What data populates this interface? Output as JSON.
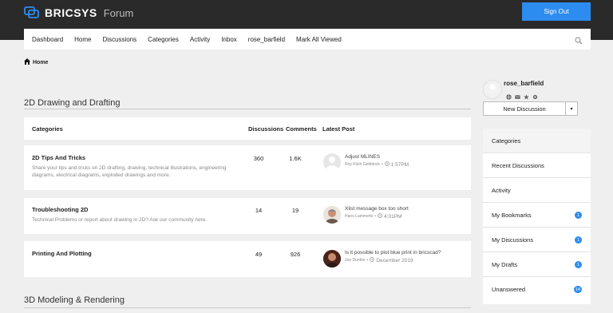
{
  "header": {
    "brand": "BRICSYS",
    "product": "Forum",
    "signout_label": "Sign Out"
  },
  "nav": {
    "items": [
      "Dashboard",
      "Home",
      "Discussions",
      "Categories",
      "Activity",
      "Inbox",
      "rose_barfield",
      "Mark All Viewed"
    ]
  },
  "breadcrumb": {
    "home": "Home"
  },
  "section1": {
    "title": "2D Drawing and Drafting",
    "headers": {
      "categories": "Categories",
      "discussions": "Discussions",
      "comments": "Comments",
      "latest": "Latest Post"
    },
    "rows": [
      {
        "name": "2D Tips And Tricks",
        "desc": "Share your tips and tricks on 2D drafting, drawing, technical illustrations, engineering diagrams, electrical diagrams, exploded drawings and more.",
        "discussions": "360",
        "comments": "1.6K",
        "post_title": "Adjust MLINES",
        "post_author": "Roy Klein Gebbinck",
        "post_sep": "•",
        "post_time": "1:57PM"
      },
      {
        "name": "Troubleshooting 2D",
        "desc": "Technical Problems or report about drawing in 2D? Ask our community here.",
        "discussions": "14",
        "comments": "19",
        "post_title": "Xlist message box too short",
        "post_author": "Hans Lammerts",
        "post_sep": "•",
        "post_time": "4:01PM"
      },
      {
        "name": "Printing And Plotting",
        "desc": "",
        "discussions": "49",
        "comments": "926",
        "post_title": "Is it possible to plot blue print in bricscad?",
        "post_author": "Joe Dunfee",
        "post_sep": "•",
        "post_time": "December 2019"
      }
    ]
  },
  "section2": {
    "title": "3D Modeling & Rendering"
  },
  "sidebar": {
    "username": "rose_barfield",
    "new_discussion": "New Discussion",
    "items": [
      {
        "label": "Categories",
        "count": ""
      },
      {
        "label": "Recent Discussions",
        "count": ""
      },
      {
        "label": "Activity",
        "count": ""
      },
      {
        "label": "My Bookmarks",
        "count": "1"
      },
      {
        "label": "My Discussions",
        "count": "1"
      },
      {
        "label": "My Drafts",
        "count": "1"
      },
      {
        "label": "Unanswered",
        "count": "14"
      }
    ]
  },
  "colors": {
    "accent": "#2d8cf0",
    "topbar": "#2a2a2a",
    "background": "#efefef"
  }
}
